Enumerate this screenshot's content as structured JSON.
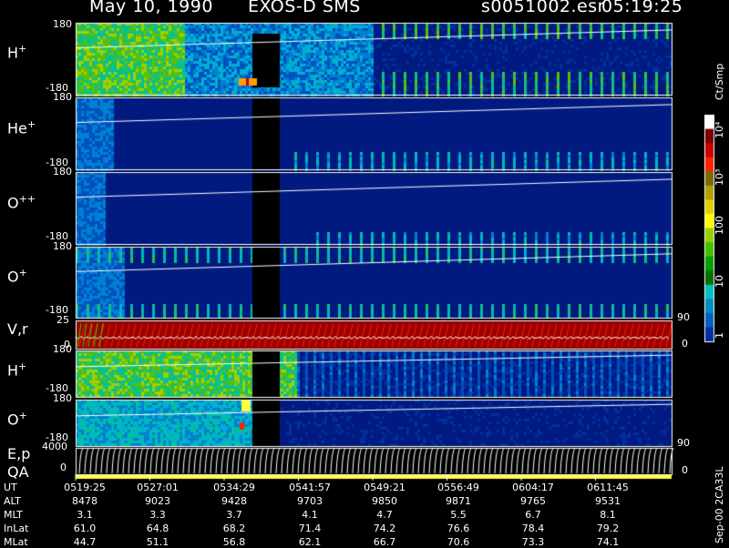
{
  "header": {
    "date": "May 10, 1990",
    "mission": "EXOS-D SMS",
    "file": "s0051002.esr",
    "time": "05:19:25"
  },
  "panels": [
    {
      "label": "H",
      "sup": "+",
      "top_tick": "180",
      "bot_tick": "-180",
      "kind": "angle"
    },
    {
      "label": "He",
      "sup": "+",
      "top_tick": "180",
      "bot_tick": "-180",
      "kind": "angle"
    },
    {
      "label": "O",
      "sup": "++",
      "top_tick": "180",
      "bot_tick": "-180",
      "kind": "angle"
    },
    {
      "label": "O",
      "sup": "+",
      "top_tick": "180",
      "bot_tick": "-180",
      "kind": "angle"
    },
    {
      "label": "V,r",
      "sup": "",
      "top_tick": "25",
      "bot_tick": "0",
      "right_top": "90",
      "right_bot": "0",
      "kind": "vr"
    },
    {
      "label": "H",
      "sup": "+",
      "top_tick": "180",
      "bot_tick": "-180",
      "kind": "angle2"
    },
    {
      "label": "O",
      "sup": "+",
      "top_tick": "180",
      "bot_tick": "-180",
      "kind": "angle3"
    },
    {
      "label": "E,p",
      "sup": "",
      "top_tick": "4000",
      "bot_tick": "0",
      "right_top": "90",
      "right_bot": "0",
      "kind": "ep"
    }
  ],
  "qa_label": "QA",
  "colorbar": {
    "units": "Ct/Smp",
    "labels": [
      "10⁴",
      "10³",
      "100",
      "10",
      "1"
    ],
    "colors": [
      "#ffffff",
      "#7a0000",
      "#c80000",
      "#ff2000",
      "#7a6a00",
      "#b0a000",
      "#e0d000",
      "#ffff00",
      "#9ad000",
      "#40c000",
      "#00a000",
      "#007000",
      "#00c0c0",
      "#0090c0",
      "#0060c0",
      "#0030a0"
    ]
  },
  "side_info": "Sep-00  2CA33L",
  "table": {
    "rows": [
      {
        "label": "UT",
        "values": [
          "0519:25",
          "0527:01",
          "0534:29",
          "0541:57",
          "0549:21",
          "0556:49",
          "0604:17",
          "0611:45"
        ]
      },
      {
        "label": "ALT",
        "values": [
          "8478",
          "9023",
          "9428",
          "9703",
          "9850",
          "9871",
          "9765",
          "9531"
        ]
      },
      {
        "label": "MLT",
        "values": [
          "3.1",
          "3.3",
          "3.7",
          "4.1",
          "4.7",
          "5.5",
          "6.7",
          "8.1"
        ]
      },
      {
        "label": "InLat",
        "values": [
          "61.0",
          "64.8",
          "68.2",
          "71.4",
          "74.2",
          "76.6",
          "78.4",
          "79.2"
        ]
      },
      {
        "label": "MLat",
        "values": [
          "44.7",
          "51.1",
          "56.8",
          "62.1",
          "66.7",
          "70.6",
          "73.3",
          "74.1"
        ]
      }
    ]
  },
  "chart_data": {
    "type": "heatmap",
    "title": "May 10, 1990   EXOS-D SMS",
    "xlabel": "UT",
    "x_ticks": [
      "0519:25",
      "0527:01",
      "0534:29",
      "0541:57",
      "0549:21",
      "0556:49",
      "0604:17",
      "0611:45"
    ],
    "colorbar_units": "Ct/Smp",
    "colorbar_range": [
      1,
      10000
    ],
    "colorbar_scale": "log",
    "series": [
      {
        "name": "H+",
        "ylim": [
          -180,
          180
        ]
      },
      {
        "name": "He+",
        "ylim": [
          -180,
          180
        ]
      },
      {
        "name": "O++",
        "ylim": [
          -180,
          180
        ]
      },
      {
        "name": "O+",
        "ylim": [
          -180,
          180
        ]
      },
      {
        "name": "V,r",
        "ylim": [
          0,
          25
        ],
        "ylim_right": [
          0,
          90
        ]
      },
      {
        "name": "H+",
        "ylim": [
          -180,
          180
        ]
      },
      {
        "name": "O+",
        "ylim": [
          -180,
          180
        ]
      },
      {
        "name": "E,p",
        "ylim": [
          0,
          4000
        ],
        "ylim_right": [
          0,
          90
        ]
      }
    ]
  }
}
